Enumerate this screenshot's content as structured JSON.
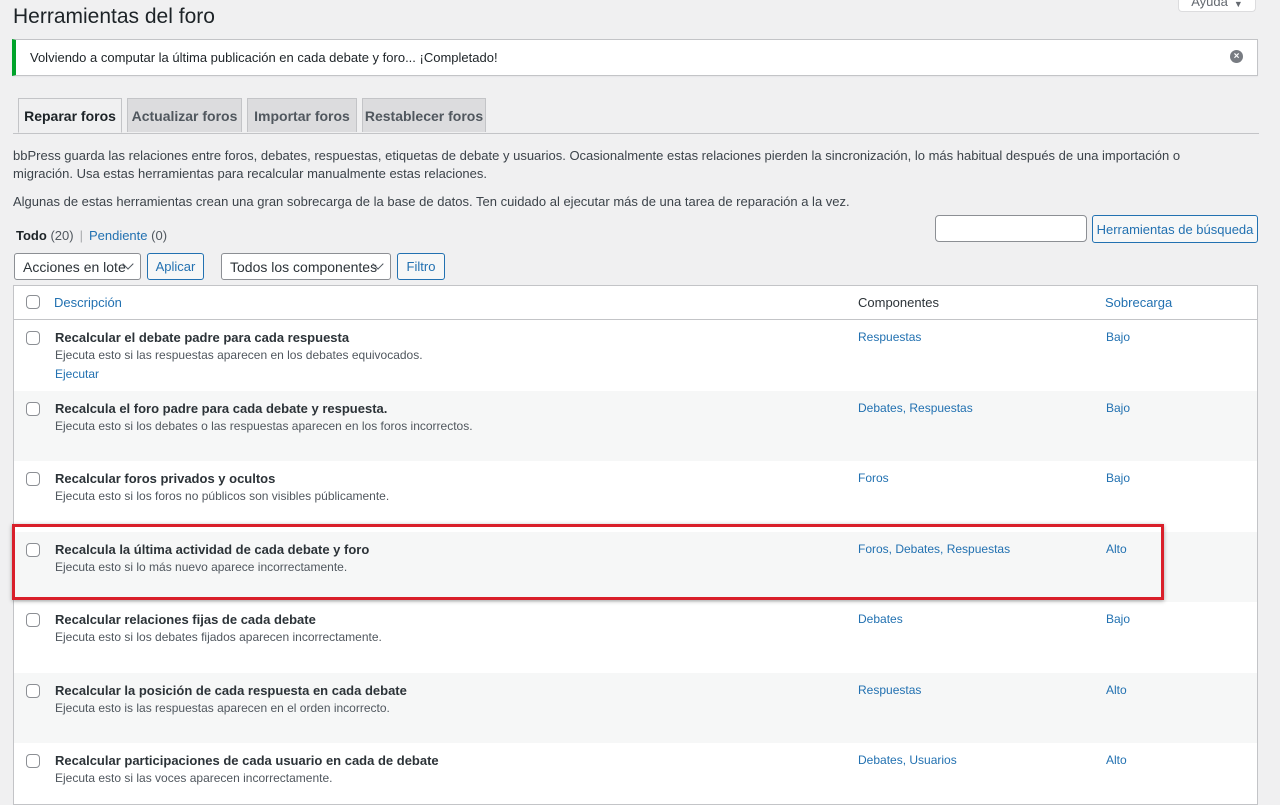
{
  "help": {
    "label": "Ayuda"
  },
  "page": {
    "title": "Herramientas del foro"
  },
  "notice": {
    "message": "Volviendo a computar la última publicación en cada debate y foro... ¡Completado!"
  },
  "tabs": [
    {
      "label": "Reparar foros",
      "active": true
    },
    {
      "label": "Actualizar foros",
      "active": false
    },
    {
      "label": "Importar foros",
      "active": false
    },
    {
      "label": "Restablecer foros",
      "active": false
    }
  ],
  "intro": {
    "paragraph1": "bbPress guarda las relaciones entre foros, debates, respuestas, etiquetas de debate y usuarios. Ocasionalmente estas relaciones pierden la sincronización, lo más habitual después de una importación o migración. Usa estas herramientas para recalcular manualmente estas relaciones.",
    "paragraph2": "Algunas de estas herramientas crean una gran sobrecarga de la base de datos. Ten cuidado al ejecutar más de una tarea de reparación a la vez."
  },
  "views": {
    "all_label": "Todo",
    "all_count": "(20)",
    "separator": "|",
    "pending_label": "Pendiente",
    "pending_count": "(0)"
  },
  "search": {
    "value": "",
    "button_label": "Herramientas de búsqueda"
  },
  "bulk": {
    "selected": "Acciones en lote",
    "apply_label": "Aplicar"
  },
  "components_filter": {
    "selected": "Todos los componentes",
    "filter_label": "Filtro"
  },
  "table": {
    "columns": {
      "description": "Descripción",
      "components": "Componentes",
      "overhead": "Sobrecarga"
    },
    "rows": [
      {
        "title": "Recalcular el debate padre para cada respuesta",
        "subtitle": "Ejecuta esto si las respuestas aparecen en los debates equivocados.",
        "action": "Ejecutar",
        "components": "Respuestas",
        "overhead": "Bajo"
      },
      {
        "title": "Recalcula el foro padre para cada debate y respuesta.",
        "subtitle": "Ejecuta esto si los debates o las respuestas aparecen en los foros incorrectos.",
        "action": "",
        "components": "Debates, Respuestas",
        "overhead": "Bajo"
      },
      {
        "title": "Recalcular foros privados y ocultos",
        "subtitle": "Ejecuta esto si los foros no públicos son visibles públicamente.",
        "action": "",
        "components": "Foros",
        "overhead": "Bajo"
      },
      {
        "title": "Recalcula la última actividad de cada debate y foro",
        "subtitle": "Ejecuta esto si lo más nuevo aparece incorrectamente.",
        "action": "",
        "components": "Foros, Debates, Respuestas",
        "overhead": "Alto"
      },
      {
        "title": "Recalcular relaciones fijas de cada debate",
        "subtitle": "Ejecuta esto si los debates fijados aparecen incorrectamente.",
        "action": "",
        "components": "Debates",
        "overhead": "Bajo"
      },
      {
        "title": "Recalcular la posición de cada respuesta en cada debate",
        "subtitle": "Ejecuta esto is las respuestas aparecen en el orden incorrecto.",
        "action": "",
        "components": "Respuestas",
        "overhead": "Alto"
      },
      {
        "title": "Recalcular participaciones de cada usuario en cada de debate",
        "subtitle": "Ejecuta esto si las voces aparecen incorrectamente.",
        "action": "",
        "components": "Debates, Usuarios",
        "overhead": "Alto"
      }
    ]
  },
  "colors": {
    "accent": "#2271b1",
    "success": "#00a32a",
    "highlight": "#d91f2a"
  }
}
